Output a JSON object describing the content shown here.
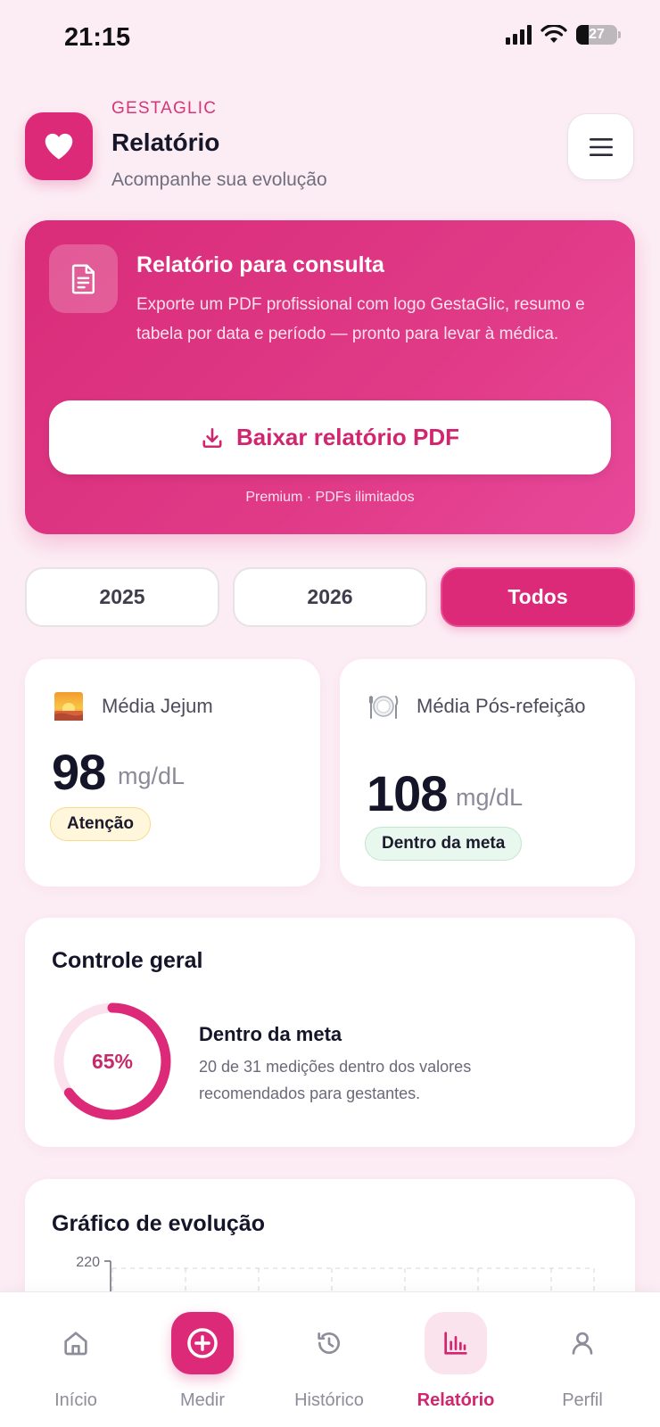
{
  "status_bar": {
    "time": "21:15",
    "battery": "27"
  },
  "header": {
    "brand": "GESTAGLIC",
    "title": "Relatório",
    "subtitle": "Acompanhe sua evolução",
    "menu_icon": "hamburger-menu-icon",
    "logo_icon": "heart-icon"
  },
  "promo": {
    "icon": "document-icon",
    "title": "Relatório para consulta",
    "description": "Exporte um PDF profissional com logo GestaGlic, resumo e tabela por data e período — pronto para levar à médica.",
    "button_label": "Baixar relatório PDF",
    "button_icon": "download-icon",
    "note": "Premium · PDFs ilimitados"
  },
  "filters": [
    {
      "label": "2025",
      "active": false
    },
    {
      "label": "2026",
      "active": false
    },
    {
      "label": "Todos",
      "active": true
    }
  ],
  "stats": [
    {
      "icon": "sunrise-icon",
      "label": "Média Jejum",
      "value": "98",
      "unit": "mg/dL",
      "badge": "Atenção",
      "status": "warning"
    },
    {
      "icon": "plate-cutlery-icon",
      "label": "Média Pós-refeição",
      "value": "108",
      "unit": "mg/dL",
      "badge": "Dentro da meta",
      "status": "ok"
    }
  ],
  "control": {
    "title": "Controle geral",
    "percent": 65,
    "percent_label": "65%",
    "heading": "Dentro da meta",
    "description": "20 de 31 medições dentro dos valores recomendados para gestantes."
  },
  "chart": {
    "title": "Gráfico de evolução",
    "y_tick_visible": "220"
  },
  "nav": [
    {
      "label": "Início",
      "icon": "home-icon",
      "active": false
    },
    {
      "label": "Medir",
      "icon": "plus-circle-icon",
      "active": false
    },
    {
      "label": "Histórico",
      "icon": "history-icon",
      "active": false
    },
    {
      "label": "Relatório",
      "icon": "bar-chart-icon",
      "active": true
    },
    {
      "label": "Perfil",
      "icon": "user-icon",
      "active": false
    }
  ],
  "colors": {
    "accent": "#dc2a78",
    "background": "#fcedf4",
    "warning_bg": "#fff6dc",
    "ok_bg": "#e9f8ee"
  }
}
